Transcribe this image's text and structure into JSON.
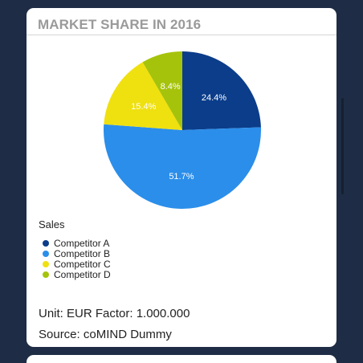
{
  "card": {
    "title": "MARKET SHARE IN 2016",
    "unit_line": "Unit: EUR Factor: 1.000.000",
    "source_line": "Source: coMIND Dummy"
  },
  "chart_data": {
    "type": "pie",
    "title": "MARKET SHARE IN 2016",
    "legend_title": "Sales",
    "legend_position": "bottom-left",
    "slices": [
      {
        "name": "Competitor A",
        "value": 24.4,
        "label": "24.4%",
        "color": "#0b3d8a"
      },
      {
        "name": "Competitor B",
        "value": 51.7,
        "label": "51.7%",
        "color": "#2b8eea"
      },
      {
        "name": "Competitor C",
        "value": 15.4,
        "label": "15.4%",
        "color": "#efe010"
      },
      {
        "name": "Competitor D",
        "value": 8.4,
        "label": "8.4%",
        "color": "#a6c30b"
      }
    ]
  }
}
